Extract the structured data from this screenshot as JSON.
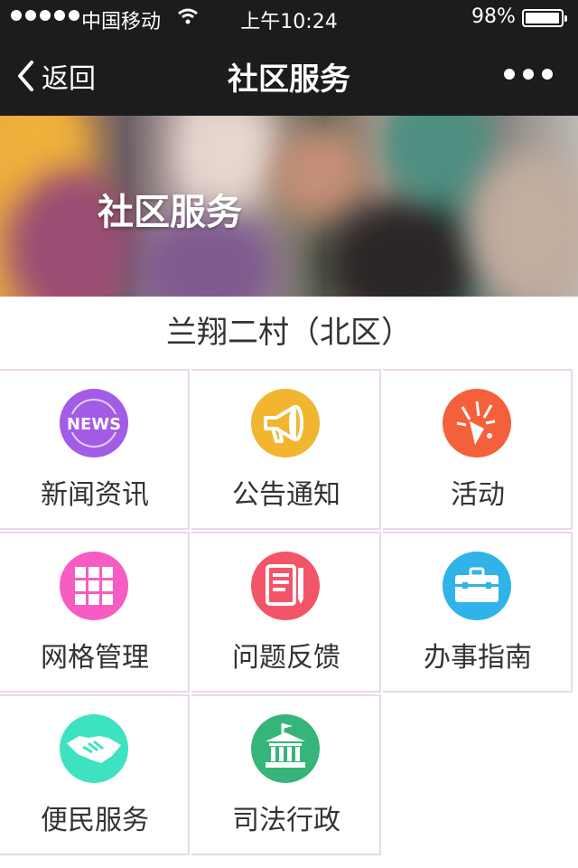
{
  "status_bar": {
    "carrier": "中国移动",
    "time": "上午10:24",
    "battery_pct": "98%",
    "battery_level": 0.98
  },
  "nav": {
    "back_label": "返回",
    "title": "社区服务"
  },
  "banner": {
    "title": "社区服务"
  },
  "location": "兰翔二村（北区）",
  "tiles": [
    {
      "label": "新闻资讯",
      "icon": "news-icon",
      "color": "#a25ce6"
    },
    {
      "label": "公告通知",
      "icon": "megaphone-icon",
      "color": "#f1b530"
    },
    {
      "label": "活动",
      "icon": "celebration-icon",
      "color": "#f5603c"
    },
    {
      "label": "网格管理",
      "icon": "grid-icon",
      "color": "#f75cc3"
    },
    {
      "label": "问题反馈",
      "icon": "feedback-icon",
      "color": "#f25567"
    },
    {
      "label": "办事指南",
      "icon": "briefcase-icon",
      "color": "#2fb3e8"
    },
    {
      "label": "便民服务",
      "icon": "handshake-icon",
      "color": "#3de3c0"
    },
    {
      "label": "司法行政",
      "icon": "courthouse-icon",
      "color": "#36b57a"
    }
  ]
}
